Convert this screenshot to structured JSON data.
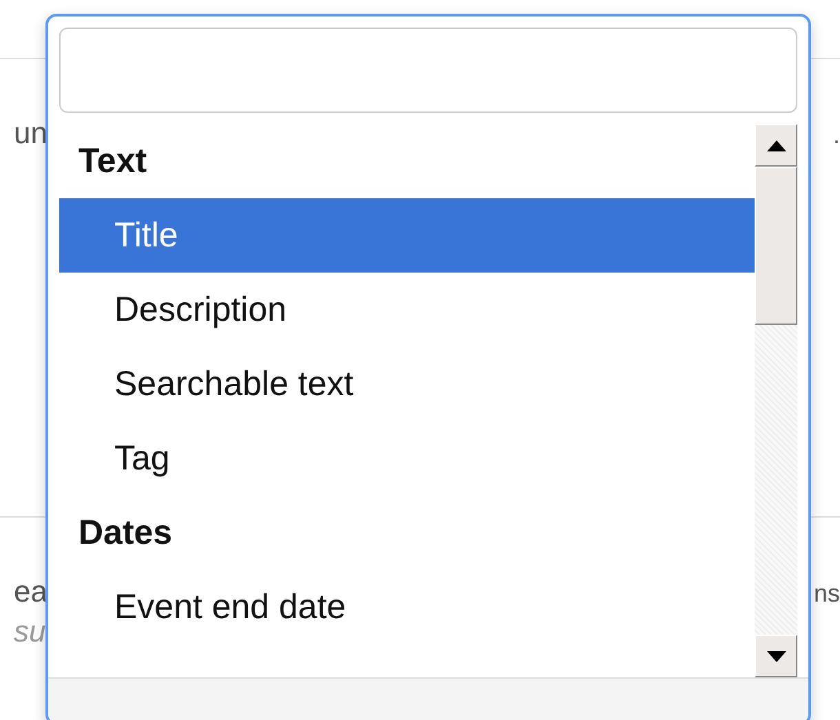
{
  "background_rows": [
    {
      "left": "un",
      "right": "."
    },
    {
      "left": "ea",
      "note": "su",
      "right": "ns"
    }
  ],
  "dropdown": {
    "groups": [
      {
        "label": "Text",
        "options": [
          {
            "label": "Title",
            "selected": true
          },
          {
            "label": "Description",
            "selected": false
          },
          {
            "label": "Searchable text",
            "selected": false
          },
          {
            "label": "Tag",
            "selected": false
          }
        ]
      },
      {
        "label": "Dates",
        "options": [
          {
            "label": "Event end date",
            "selected": false
          }
        ]
      }
    ]
  }
}
